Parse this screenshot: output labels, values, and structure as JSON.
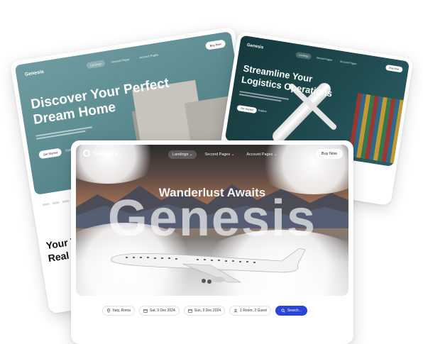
{
  "back_card_1": {
    "logo": "Genesis",
    "nav": [
      "Landings",
      "Second Pages",
      "Account Pages"
    ],
    "buy_label": "Buy Now",
    "title": "Discover Your Perfect Dream Home",
    "cta_primary": "Get Started",
    "cta_secondary": "Explore",
    "section_title": "Your T\nReal"
  },
  "back_card_2": {
    "logo": "Genesis",
    "nav": [
      "Landings",
      "Second Pages",
      "Account Pages"
    ],
    "buy_label": "Buy Now",
    "title": "Streamline Your Logistics Operations",
    "cta_primary": "Get Started",
    "cta_secondary": "Explore"
  },
  "front": {
    "logo": "Genesis",
    "nav": [
      "Landings ⌄",
      "Second Pages ⌄",
      "Account Pages ⌄"
    ],
    "buy_label": "Buy Now",
    "tagline": "Wanderlust Awaits",
    "big_word": "Genesis",
    "search": {
      "location": "Italy, Roma",
      "checkin": "Sat, 3 Dec 2024",
      "checkout": "Sun, 3 Dec 2024",
      "guests": "1 Room, 2 Guest",
      "button": "Search..."
    }
  },
  "colors": {
    "accent": "#2c44d8",
    "teal": "#5a8a8f",
    "dark_teal": "#1f4b4f"
  }
}
